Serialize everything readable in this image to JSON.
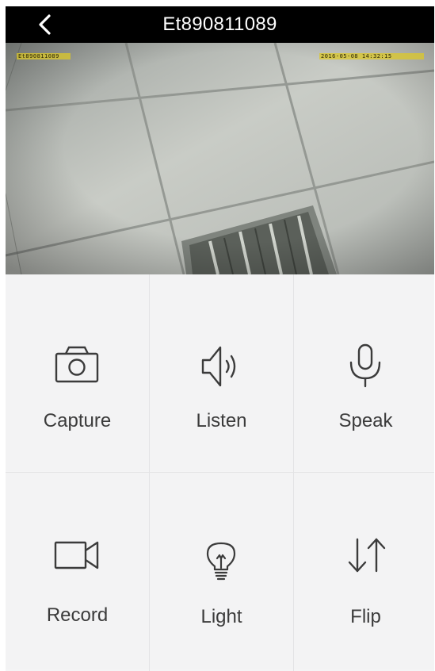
{
  "header": {
    "title": "Et890811089",
    "back_icon": "chevron-left-icon"
  },
  "video": {
    "osd_device_id": "Et890811089",
    "osd_timestamp": "2016-05-08 14:32:15"
  },
  "controls": [
    {
      "label": "Capture",
      "icon": "camera-icon"
    },
    {
      "label": "Listen",
      "icon": "speaker-icon"
    },
    {
      "label": "Speak",
      "icon": "microphone-icon"
    },
    {
      "label": "Record",
      "icon": "video-camera-icon"
    },
    {
      "label": "Light",
      "icon": "lightbulb-icon"
    },
    {
      "label": "Flip",
      "icon": "flip-arrows-icon"
    }
  ],
  "colors": {
    "header_bg": "#000000",
    "panel_bg": "#f3f3f4",
    "icon_color": "#3b3b3b",
    "osd_color": "#dcc828"
  }
}
